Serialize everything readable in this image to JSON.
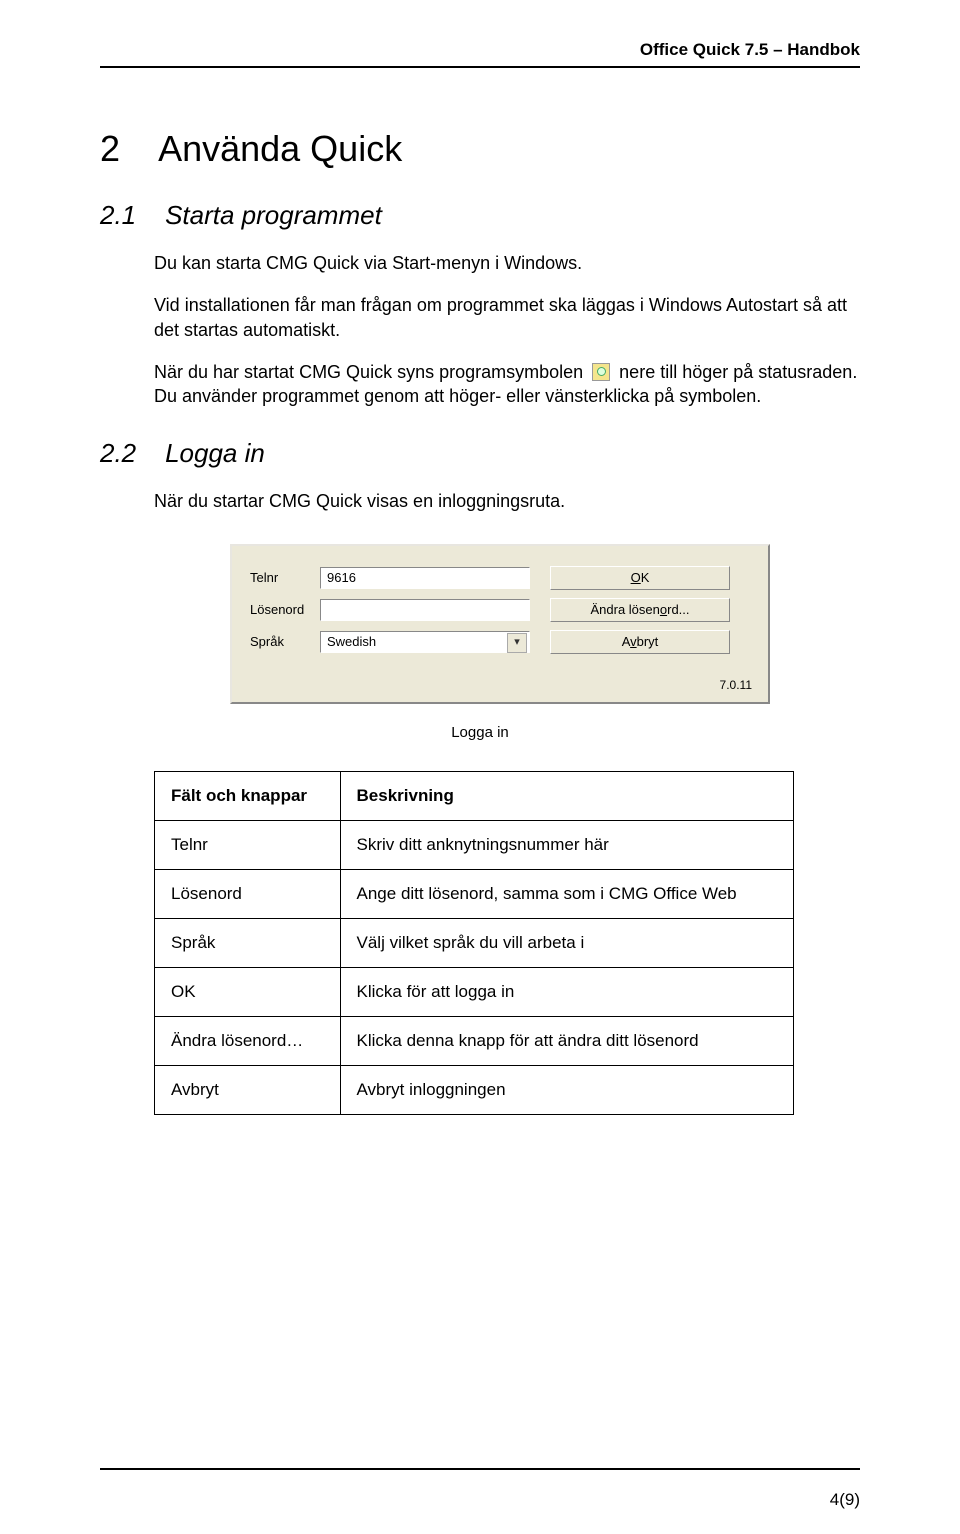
{
  "header": {
    "title": "Office Quick 7.5 – Handbok"
  },
  "section": {
    "number": "2",
    "title": "Använda Quick",
    "s1": {
      "number": "2.1",
      "title": "Starta programmet",
      "p1": "Du kan starta CMG Quick via Start-menyn i Windows.",
      "p2": "Vid installationen får man frågan om programmet ska läggas i Windows Autostart så att det startas automatiskt.",
      "p3a": "När du har startat CMG Quick syns programsymbolen ",
      "p3b": " nere till höger på statusraden. Du använder programmet genom att höger- eller vänsterklicka på symbolen."
    },
    "s2": {
      "number": "2.2",
      "title": "Logga in",
      "p1": "När du startar CMG Quick visas en inloggningsruta."
    }
  },
  "login_shot": {
    "labels": {
      "telnr": "Telnr",
      "losenord": "Lösenord",
      "sprak": "Språk"
    },
    "values": {
      "telnr": "9616",
      "losenord": "",
      "sprak": "Swedish"
    },
    "buttons": {
      "ok": "OK",
      "andra": "Ändra lösenord...",
      "avbryt": "Avbryt"
    },
    "version": "7.0.11",
    "caption": "Logga in"
  },
  "table": {
    "headers": [
      "Fält och knappar",
      "Beskrivning"
    ],
    "rows": [
      [
        "Telnr",
        "Skriv ditt anknytningsnummer här"
      ],
      [
        "Lösenord",
        "Ange ditt lösenord, samma som i CMG Office Web"
      ],
      [
        "Språk",
        "Välj vilket språk du vill arbeta i"
      ],
      [
        "OK",
        "Klicka för att logga in"
      ],
      [
        "Ändra lösenord…",
        "Klicka denna knapp för att ändra ditt lösenord"
      ],
      [
        "Avbryt",
        "Avbryt inloggningen"
      ]
    ]
  },
  "footer": {
    "page": "4(9)"
  }
}
